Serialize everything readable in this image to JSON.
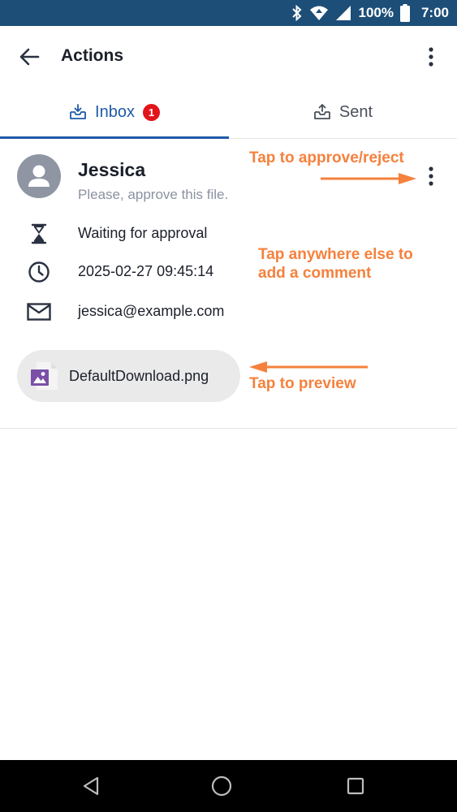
{
  "status_bar": {
    "battery": "100%",
    "time": "7:00"
  },
  "app_bar": {
    "title": "Actions"
  },
  "tabs": [
    {
      "label": "Inbox",
      "badge": "1",
      "active": true
    },
    {
      "label": "Sent",
      "active": false
    }
  ],
  "action_item": {
    "sender": "Jessica",
    "message": "Please, approve this file.",
    "status": "Waiting for approval",
    "timestamp": "2025-02-27 09:45:14",
    "email": "jessica@example.com",
    "attachment": "DefaultDownload.png"
  },
  "annotations": {
    "approve": "Tap to approve/reject",
    "comment_line1": "Tap anywhere else to",
    "comment_line2": "add a comment",
    "preview": "Tap to preview"
  },
  "colors": {
    "status_bar": "#1c4e78",
    "accent": "#1f5aa8",
    "badge": "#e3141b",
    "annotation": "#f5813d",
    "file_icon": "#7b4fa8"
  },
  "icons": {
    "back": "arrow-left-icon",
    "overflow": "more-vert-icon",
    "inbox_tab": "inbox-tray-icon",
    "sent_tab": "outbox-tray-icon",
    "status": "hourglass-icon",
    "time": "clock-icon",
    "email": "envelope-icon",
    "file": "image-file-icon"
  }
}
